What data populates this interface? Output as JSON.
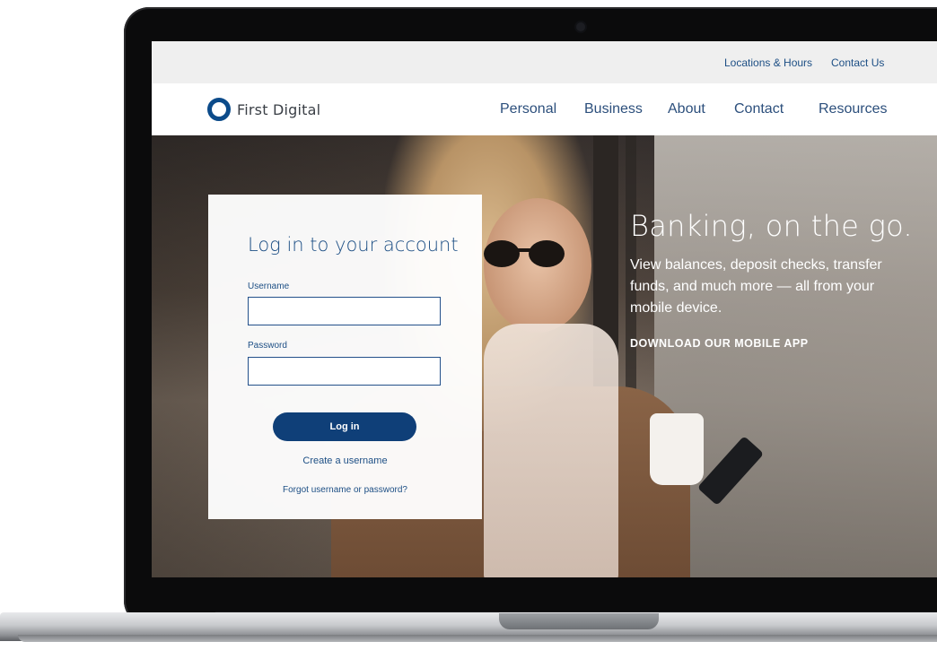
{
  "utility": {
    "locations": "Locations & Hours",
    "contact": "Contact Us"
  },
  "brand": {
    "name": "First Digital"
  },
  "nav": [
    "Personal",
    "Business",
    "About",
    "Contact",
    "Resources"
  ],
  "login": {
    "title": "Log in to your account",
    "username_label": "Username",
    "username_value": "",
    "password_label": "Password",
    "password_value": "",
    "submit_label": "Log in",
    "create_link": "Create a username",
    "forgot_link": "Forgot username or password?"
  },
  "hero": {
    "title": "Banking, on the go.",
    "body": "View balances, deposit checks, transfer funds, and much more — all from your mobile device.",
    "cta": "DOWNLOAD OUR MOBILE APP"
  },
  "colors": {
    "brand_blue": "#0c4b8a",
    "button_blue": "#0f3f78",
    "link_blue": "#1d4f85"
  }
}
